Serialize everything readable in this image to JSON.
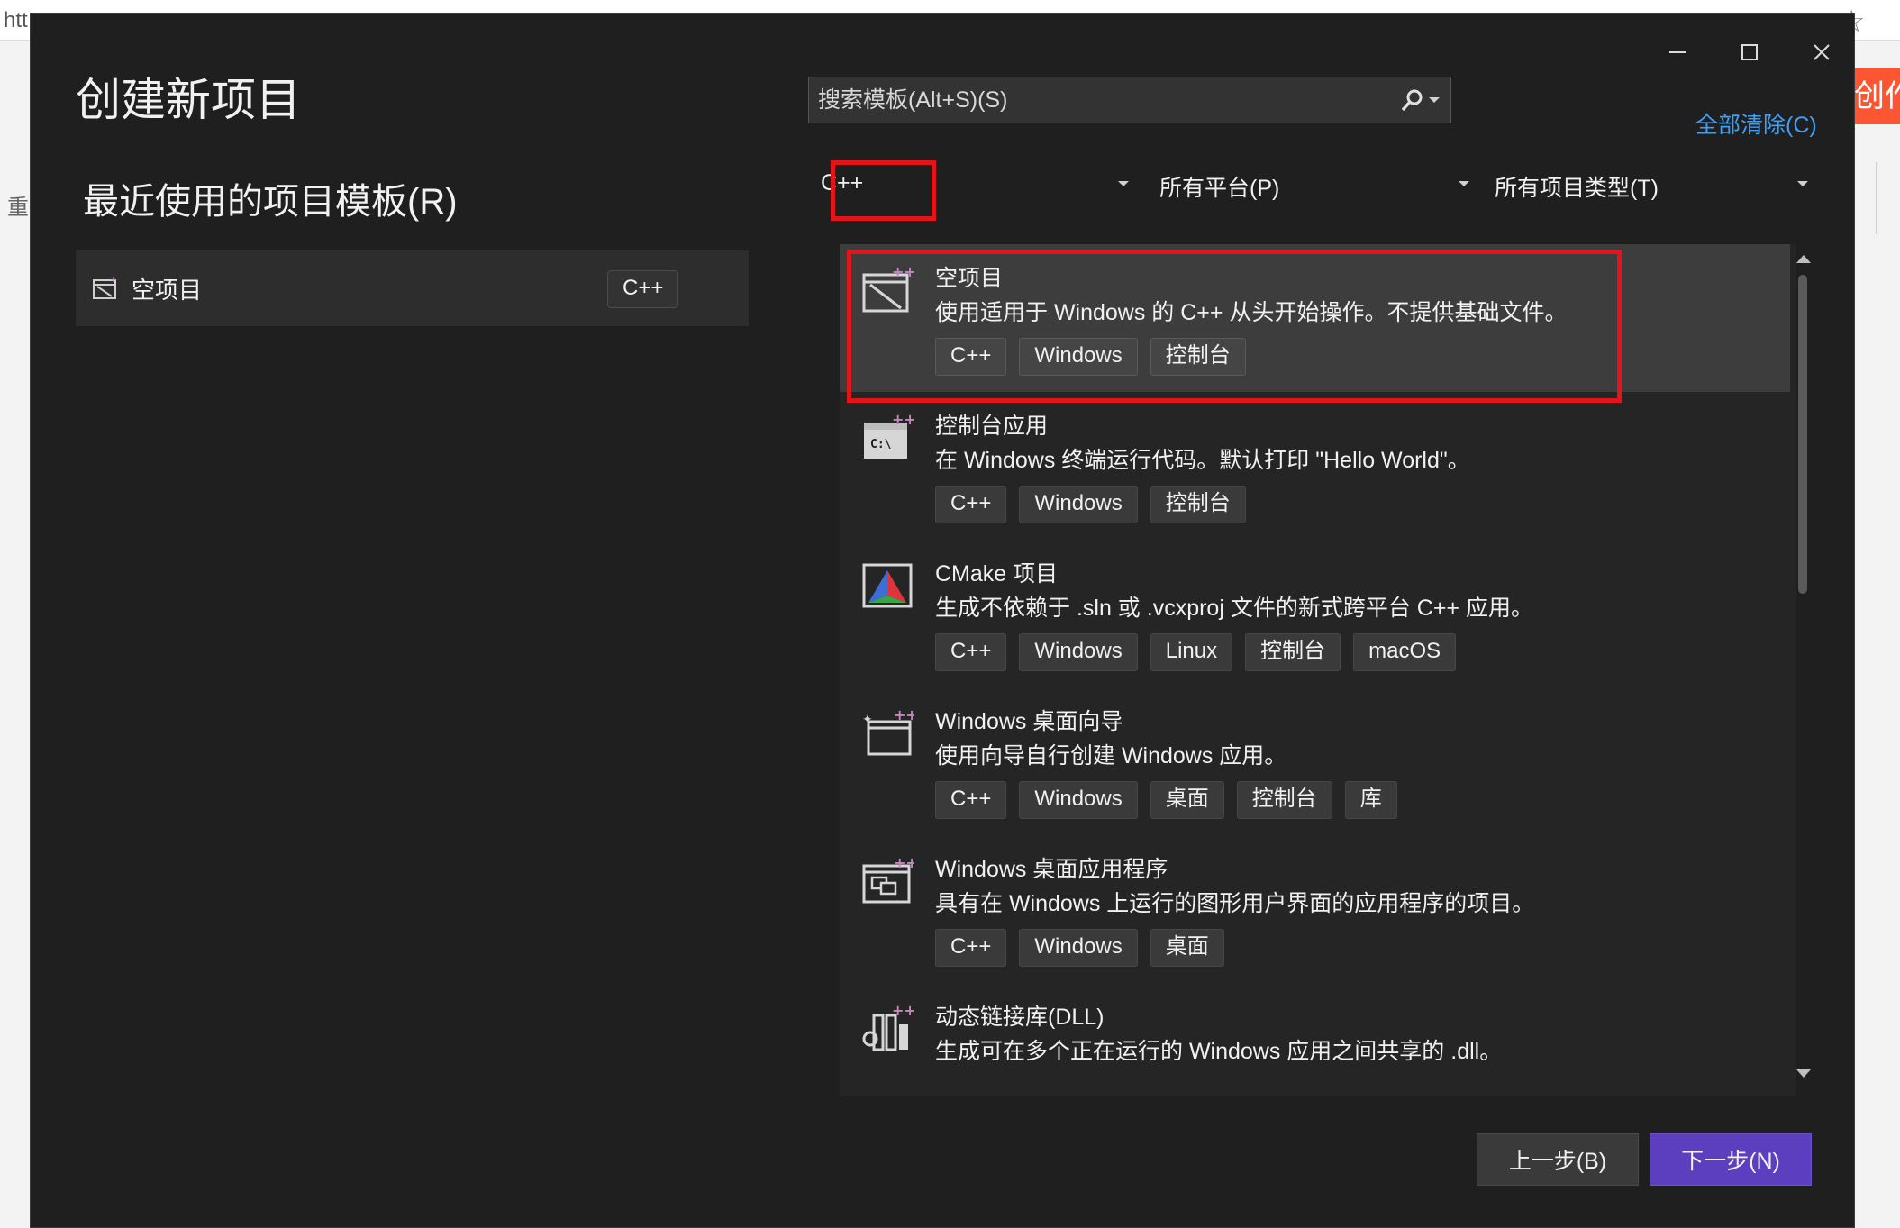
{
  "background": {
    "url_fragment": "htt",
    "left_fragment": "重",
    "right_button": "创作"
  },
  "dialog": {
    "title": "创建新项目",
    "recent_heading": "最近使用的项目模板(R)",
    "recent_items": [
      {
        "label": "空项目",
        "tag": "C++",
        "icon": "empty-project-icon"
      }
    ],
    "search": {
      "placeholder": "搜索模板(Alt+S)(S)",
      "value": ""
    },
    "clear_all": "全部清除(C)",
    "filters": {
      "language": "C++",
      "platform": "所有平台(P)",
      "project_type": "所有项目类型(T)"
    },
    "templates": [
      {
        "title": "空项目",
        "description": "使用适用于 Windows 的 C++ 从头开始操作。不提供基础文件。",
        "tags": [
          "C++",
          "Windows",
          "控制台"
        ],
        "icon": "empty-project-icon",
        "selected": true
      },
      {
        "title": "控制台应用",
        "description": "在 Windows 终端运行代码。默认打印 \"Hello World\"。",
        "tags": [
          "C++",
          "Windows",
          "控制台"
        ],
        "icon": "console-app-icon",
        "selected": false
      },
      {
        "title": "CMake 项目",
        "description": "生成不依赖于 .sln 或 .vcxproj 文件的新式跨平台 C++ 应用。",
        "tags": [
          "C++",
          "Windows",
          "Linux",
          "控制台",
          "macOS"
        ],
        "icon": "cmake-icon",
        "selected": false
      },
      {
        "title": "Windows 桌面向导",
        "description": "使用向导自行创建 Windows 应用。",
        "tags": [
          "C++",
          "Windows",
          "桌面",
          "控制台",
          "库"
        ],
        "icon": "desktop-wizard-icon",
        "selected": false
      },
      {
        "title": "Windows 桌面应用程序",
        "description": "具有在 Windows 上运行的图形用户界面的应用程序的项目。",
        "tags": [
          "C++",
          "Windows",
          "桌面"
        ],
        "icon": "desktop-app-icon",
        "selected": false
      },
      {
        "title": "动态链接库(DLL)",
        "description": "生成可在多个正在运行的 Windows 应用之间共享的 .dll。",
        "tags": [],
        "icon": "dll-icon",
        "selected": false
      }
    ],
    "buttons": {
      "back": "上一步(B)",
      "next": "下一步(N)"
    },
    "colors": {
      "accent": "#5b3fbf",
      "link": "#3e9ff5",
      "highlight": "#e4141b",
      "background": "#1f1f1f"
    }
  }
}
